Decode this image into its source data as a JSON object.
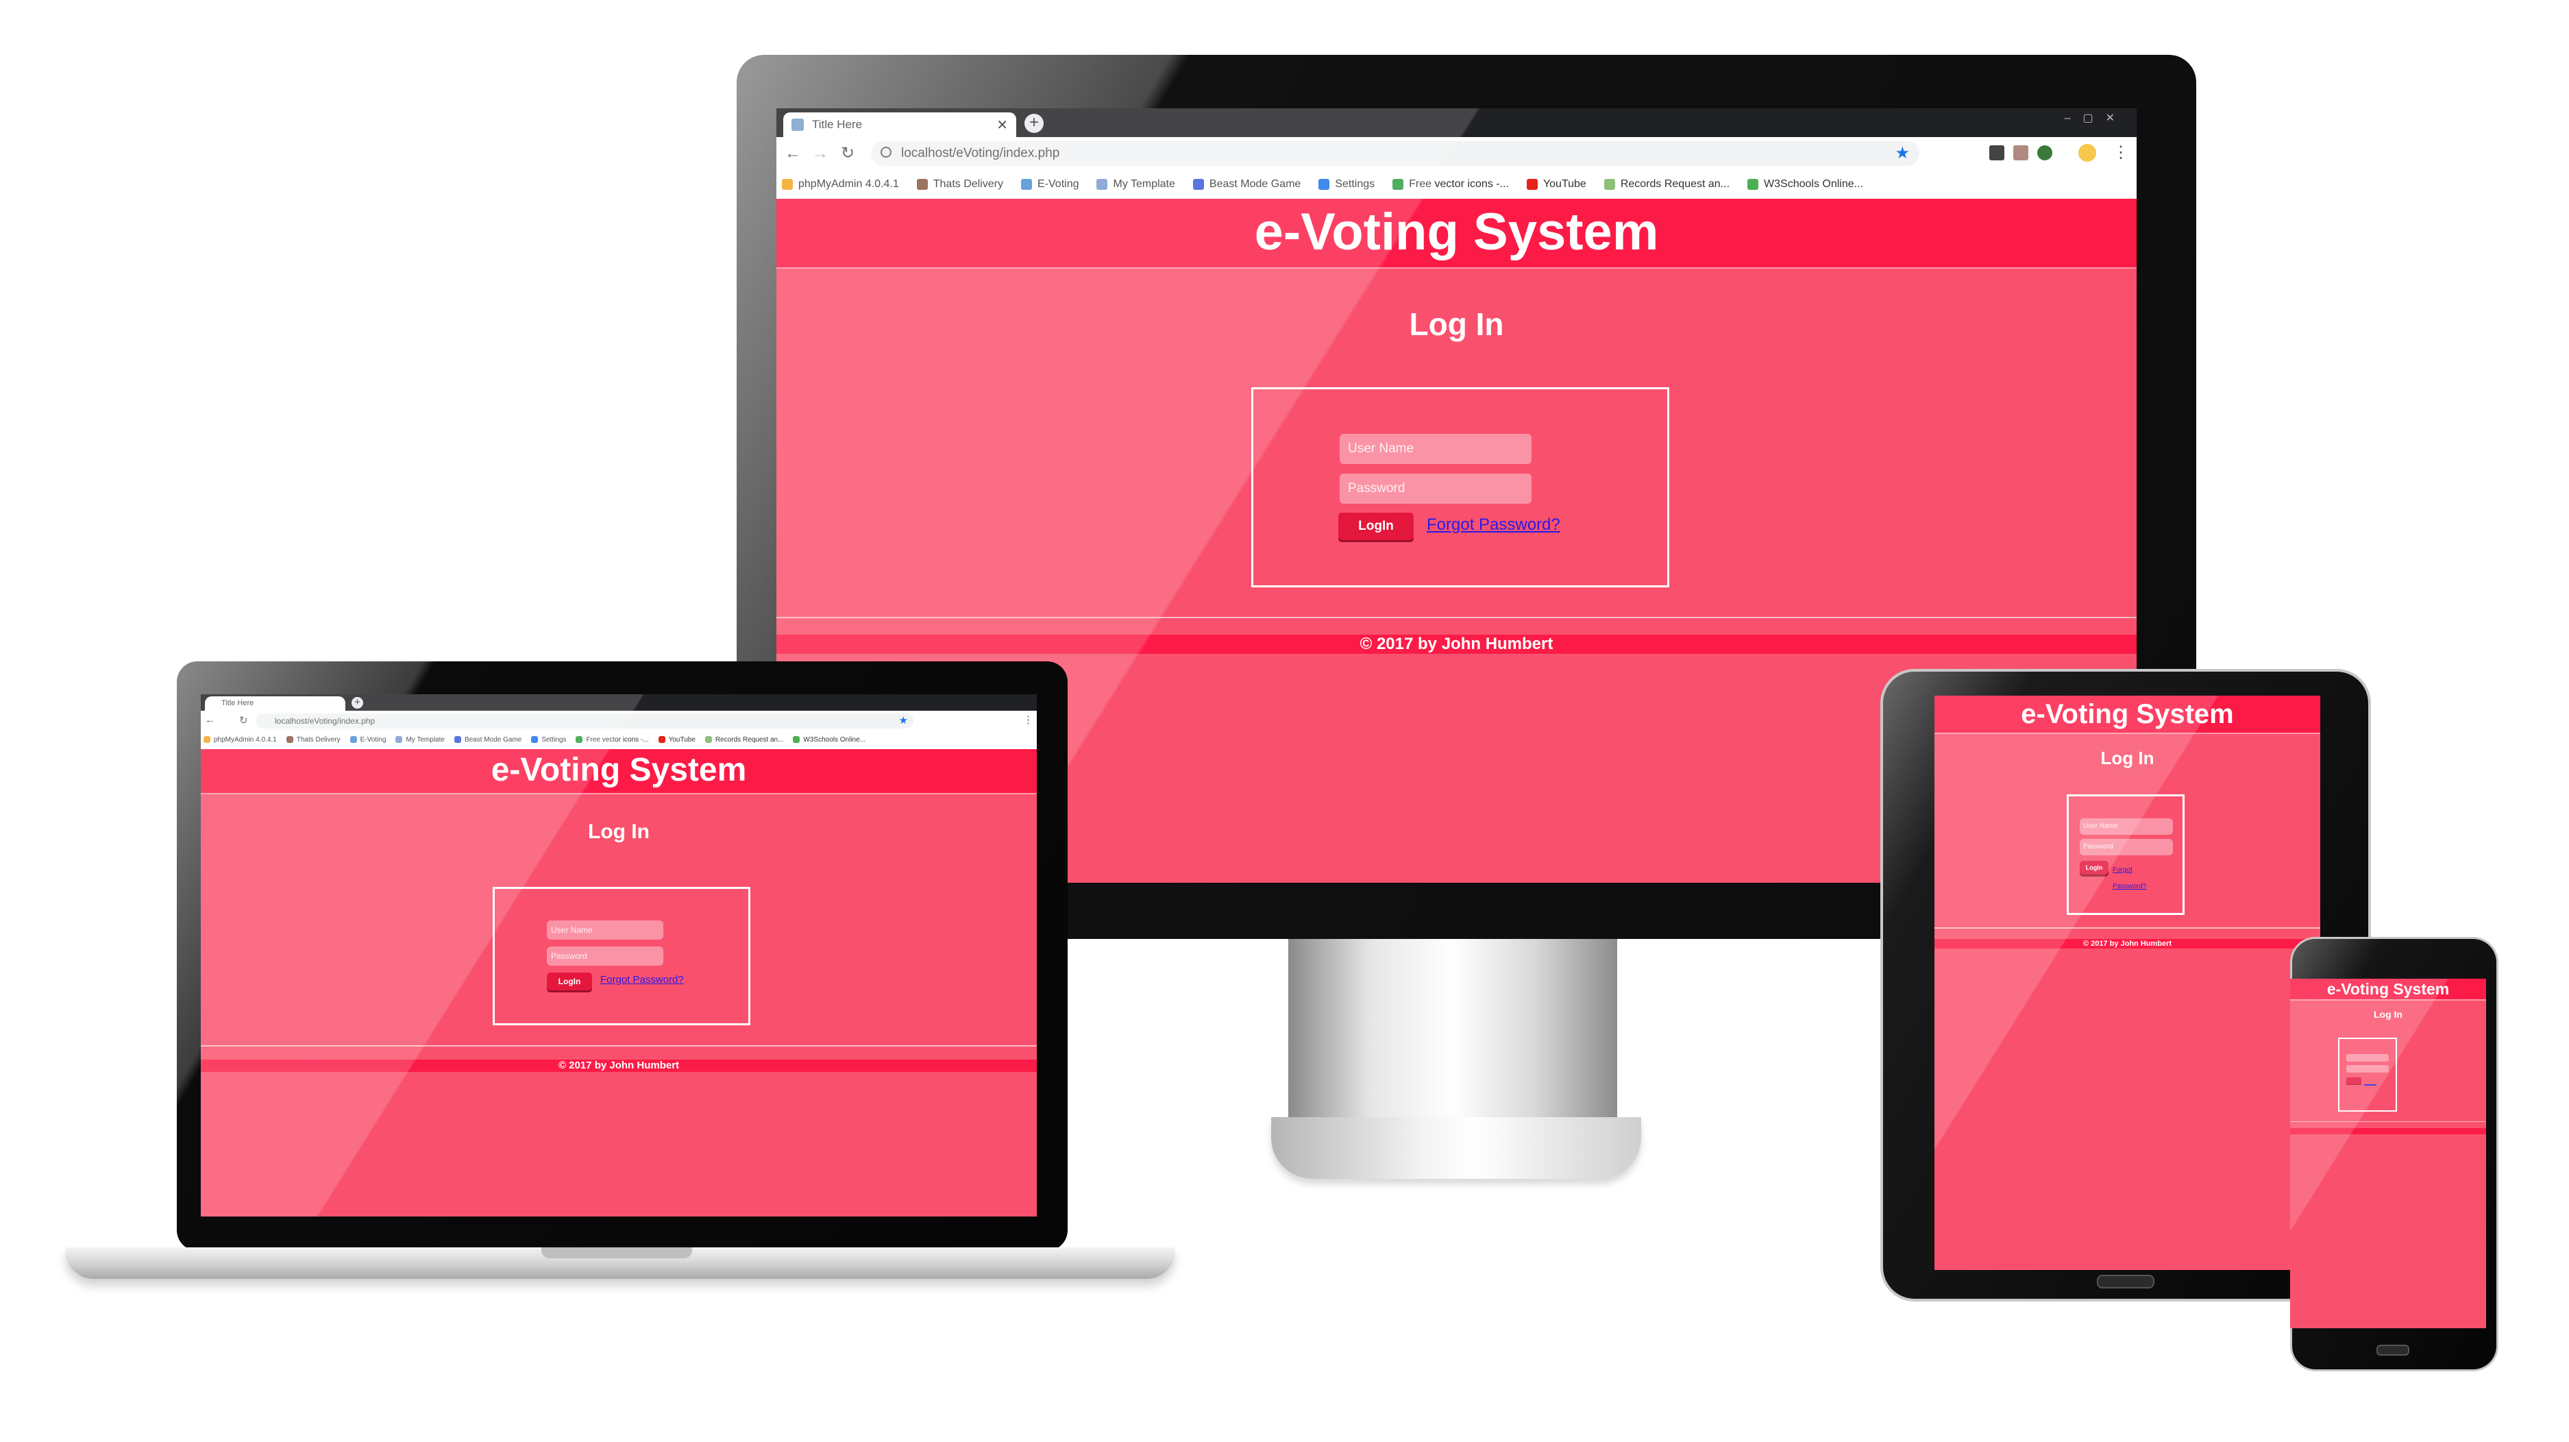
{
  "browser": {
    "tab_title": "Title Here",
    "new_tab": "+",
    "url": "localhost/eVoting/index.php",
    "bookmarks": [
      {
        "label": "phpMyAdmin 4.0.4.1",
        "color": "#f5a623"
      },
      {
        "label": "Thats Delivery",
        "color": "#8a5a44"
      },
      {
        "label": "E-Voting",
        "color": "#4a90d9"
      },
      {
        "label": "My Template",
        "color": "#7b9bd1"
      },
      {
        "label": "Beast Mode Game",
        "color": "#3b5bdb"
      },
      {
        "label": "Settings",
        "color": "#1a73e8"
      },
      {
        "label": "Free vector icons -...",
        "color": "#2f9e44"
      },
      {
        "label": "YouTube",
        "color": "#e62117"
      },
      {
        "label": "Records Request an...",
        "color": "#8ec07c"
      },
      {
        "label": "W3Schools Online...",
        "color": "#4caf50"
      }
    ],
    "more": "»"
  },
  "site": {
    "header_title": "e-Voting System",
    "login_title": "Log In",
    "username_placeholder": "User Name",
    "password_placeholder": "Password",
    "login_button": "LogIn",
    "forgot_link": "Forgot Password?",
    "footer": "© 2017 by John Humbert"
  },
  "colors": {
    "page": "#f9516d",
    "header": "#fc1b47",
    "button": "#e4173d",
    "link": "#2a19e6"
  }
}
